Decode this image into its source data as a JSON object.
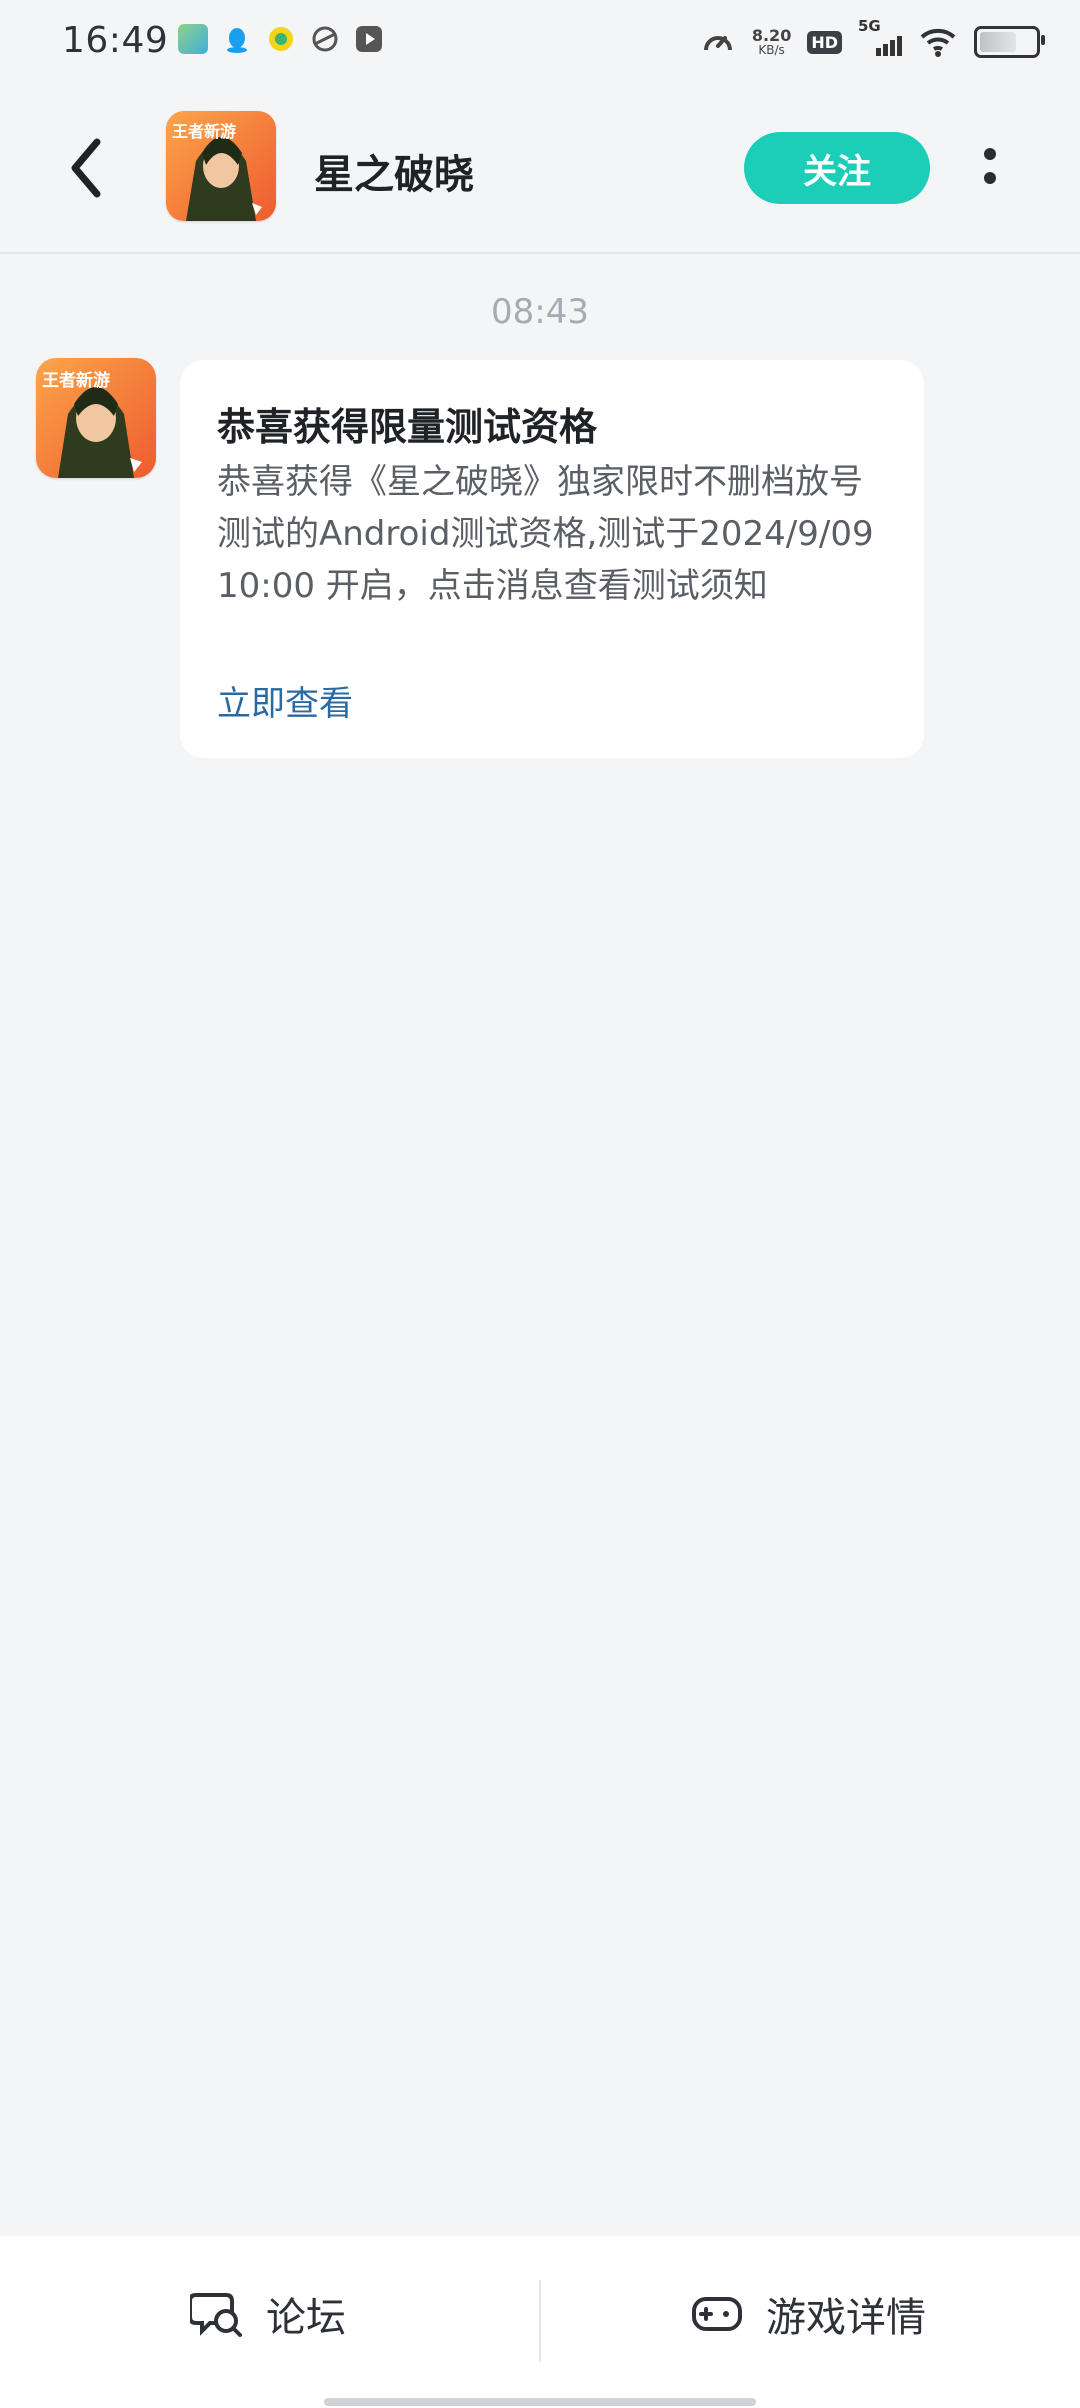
{
  "status": {
    "time": "16:49",
    "speed_value": "8.20",
    "speed_unit": "KB/s",
    "hd": "HD",
    "network": "5G"
  },
  "header": {
    "title": "星之破晓",
    "follow_label": "关注",
    "avatar_banner": "王者新游"
  },
  "chat": {
    "timestamp": "08:43",
    "message": {
      "title": "恭喜获得限量测试资格",
      "body": "恭喜获得《星之破晓》独家限时不删档放号测试的Android测试资格,测试于2024/9/09 10:00 开启，点击消息查看测试须知",
      "link": "立即查看"
    }
  },
  "bottom_bar": {
    "forum_label": "论坛",
    "game_detail_label": "游戏详情"
  },
  "colors": {
    "accent": "#1ccdb8",
    "link": "#2a6aa3",
    "background": "#f4f5f7"
  }
}
